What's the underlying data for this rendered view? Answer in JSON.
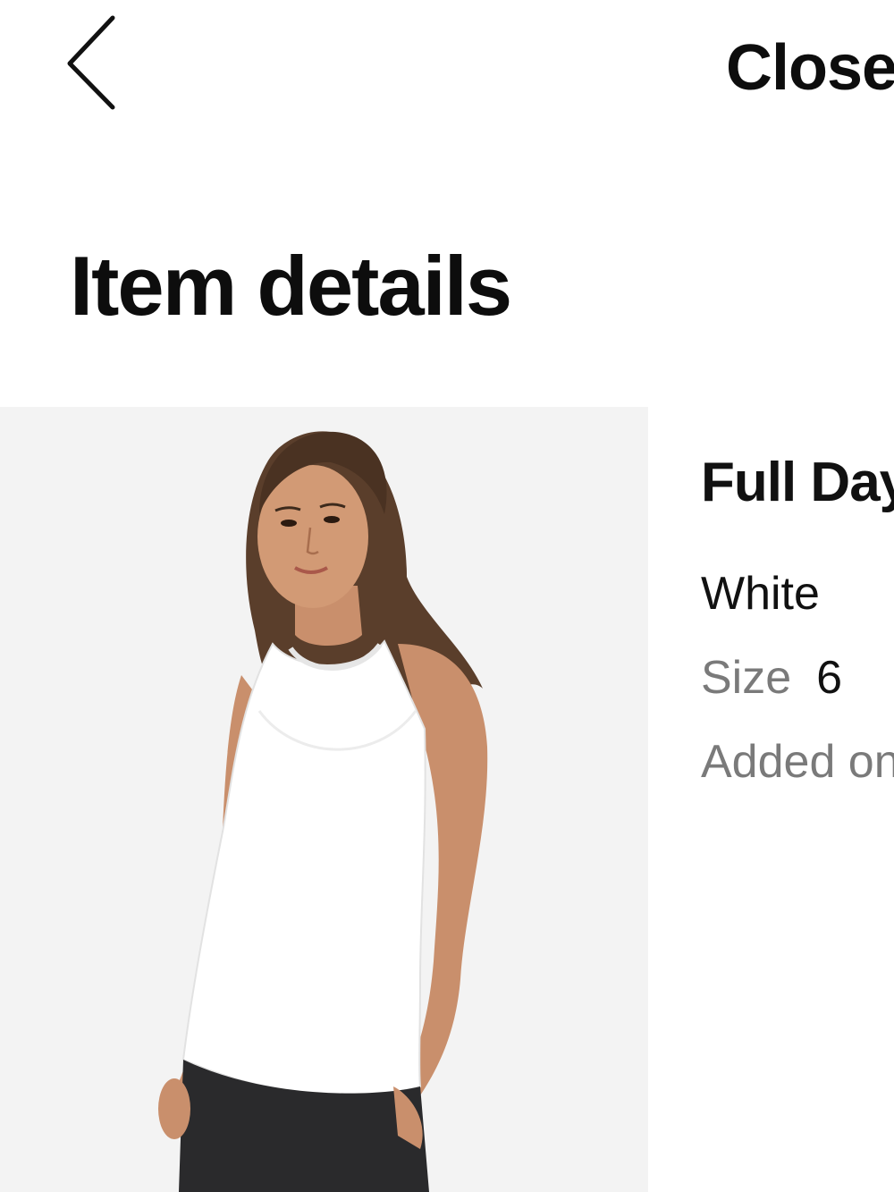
{
  "header": {
    "back_icon": "chevron-left-icon",
    "close_label": "Close"
  },
  "page": {
    "title": "Item details"
  },
  "item": {
    "image_description_icon": "product-photo",
    "name": "Full Day",
    "color": "White",
    "size_label": "Size",
    "size_value": "6",
    "added_on_label": "Added on"
  },
  "colors": {
    "text_primary": "#111111",
    "text_secondary": "#7a7a7a",
    "image_background": "#f3f3f3"
  }
}
